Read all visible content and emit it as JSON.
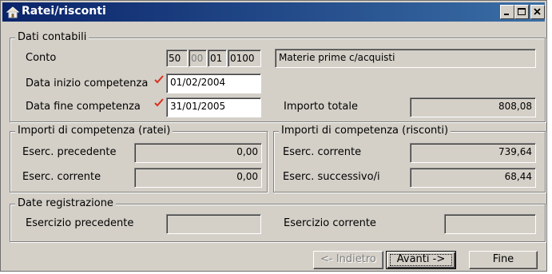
{
  "window": {
    "title": "Ratei/risconti"
  },
  "window_controls": {
    "minimize": "minimize",
    "maximize": "maximize",
    "close": "close"
  },
  "dati_contabili": {
    "legend": "Dati contabili",
    "conto_label": "Conto",
    "conto_segments": [
      "50",
      "00",
      "01",
      "0100"
    ],
    "conto_description": "Materie prime c/acquisti",
    "data_inizio_label": "Data inizio competenza",
    "data_inizio_value": "01/02/2004",
    "data_fine_label": "Data fine competenza",
    "data_fine_value": "31/01/2005",
    "importo_totale_label": "Importo totale",
    "importo_totale_value": "808,08"
  },
  "ratei": {
    "legend": "Importi di competenza (ratei)",
    "precedente_label": "Eserc. precedente",
    "precedente_value": "0,00",
    "corrente_label": "Eserc. corrente",
    "corrente_value": "0,00"
  },
  "risconti": {
    "legend": "Importi di competenza (risconti)",
    "corrente_label": "Eserc. corrente",
    "corrente_value": "739,64",
    "successivo_label": "Eserc. successivo/i",
    "successivo_value": "68,44"
  },
  "date_registrazione": {
    "legend": "Date registrazione",
    "precedente_label": "Esercizio precedente",
    "precedente_value": "",
    "corrente_label": "Esercizio corrente",
    "corrente_value": ""
  },
  "buttons": {
    "indietro": "<- Indietro",
    "avanti": "Avanti ->",
    "fine": "Fine"
  },
  "colors": {
    "title_bar_start": "#0a246a",
    "title_bar_end": "#3a6ea5",
    "window_face": "#d4d0c8",
    "check_mark": "#d9301f"
  },
  "icons": [
    "app-house-icon",
    "minimize-icon",
    "maximize-icon",
    "close-icon",
    "check-mark-icon"
  ]
}
